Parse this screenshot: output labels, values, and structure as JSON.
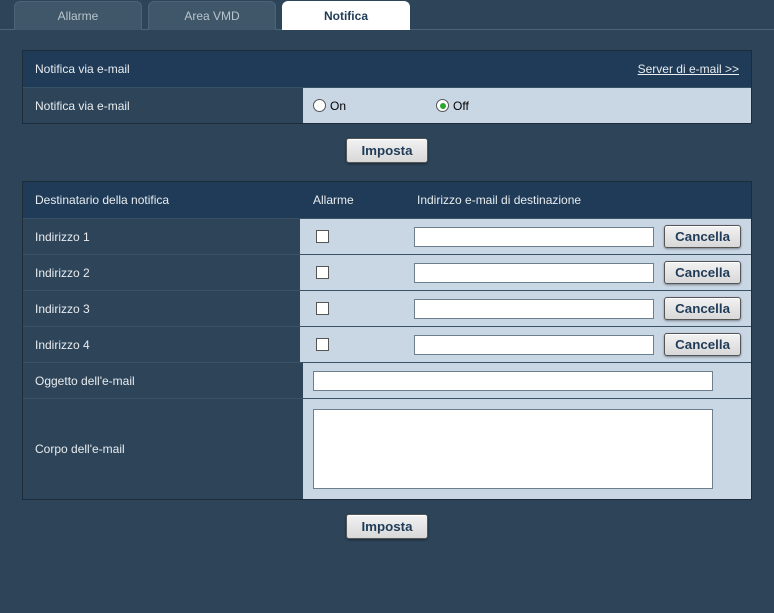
{
  "tabs": {
    "alarm": "Allarme",
    "vmd": "Area VMD",
    "notify": "Notifica"
  },
  "section1": {
    "header": "Notifica via e-mail",
    "link": "Server di e-mail >>",
    "row_label": "Notifica via e-mail",
    "on_label": "On",
    "off_label": "Off",
    "selected": "off"
  },
  "buttons": {
    "set": "Imposta",
    "cancel": "Cancella"
  },
  "section2": {
    "header_left": "Destinatario della notifica",
    "col_alarm": "Allarme",
    "col_addr": "Indirizzo e-mail di destinazione",
    "rows": [
      {
        "label": "Indirizzo 1",
        "checked": false,
        "value": ""
      },
      {
        "label": "Indirizzo 2",
        "checked": false,
        "value": ""
      },
      {
        "label": "Indirizzo 3",
        "checked": false,
        "value": ""
      },
      {
        "label": "Indirizzo 4",
        "checked": false,
        "value": ""
      }
    ],
    "subject_label": "Oggetto dell'e-mail",
    "subject_value": "",
    "body_label": "Corpo dell'e-mail",
    "body_value": ""
  }
}
